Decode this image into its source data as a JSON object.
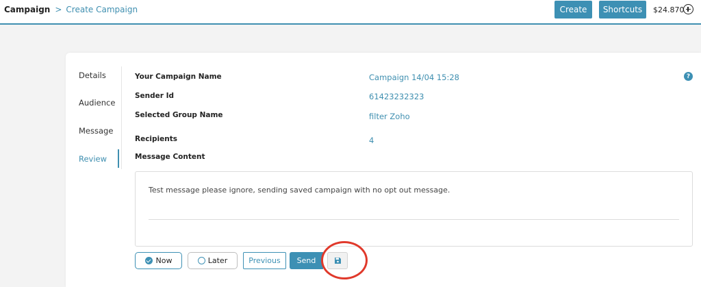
{
  "breadcrumb": {
    "root": "Campaign",
    "separator": ">",
    "current": "Create Campaign"
  },
  "header": {
    "create_label": "Create",
    "shortcuts_label": "Shortcuts",
    "balance": "$24.870"
  },
  "steps": [
    {
      "label": "Details",
      "active": false
    },
    {
      "label": "Audience",
      "active": false
    },
    {
      "label": "Message",
      "active": false
    },
    {
      "label": "Review",
      "active": true
    }
  ],
  "review": {
    "campaign_name_label": "Your Campaign Name",
    "campaign_name_value": "Campaign 14/04 15:28",
    "sender_id_label": "Sender Id",
    "sender_id_value": "61423232323",
    "group_label": "Selected Group Name",
    "group_value": "filter Zoho",
    "recipients_label": "Recipients",
    "recipients_value": "4",
    "message_label": "Message Content",
    "message_text": "Test message please ignore, sending saved campaign with no opt out message."
  },
  "schedule": {
    "now_label": "Now",
    "later_label": "Later",
    "selected": "Now"
  },
  "actions": {
    "previous_label": "Previous",
    "send_label": "Send"
  },
  "icons": {
    "help": "help-icon",
    "save": "save-icon",
    "add_funds": "plus-circle-icon"
  },
  "colors": {
    "accent": "#3d90b4",
    "highlight": "#e0392b"
  }
}
